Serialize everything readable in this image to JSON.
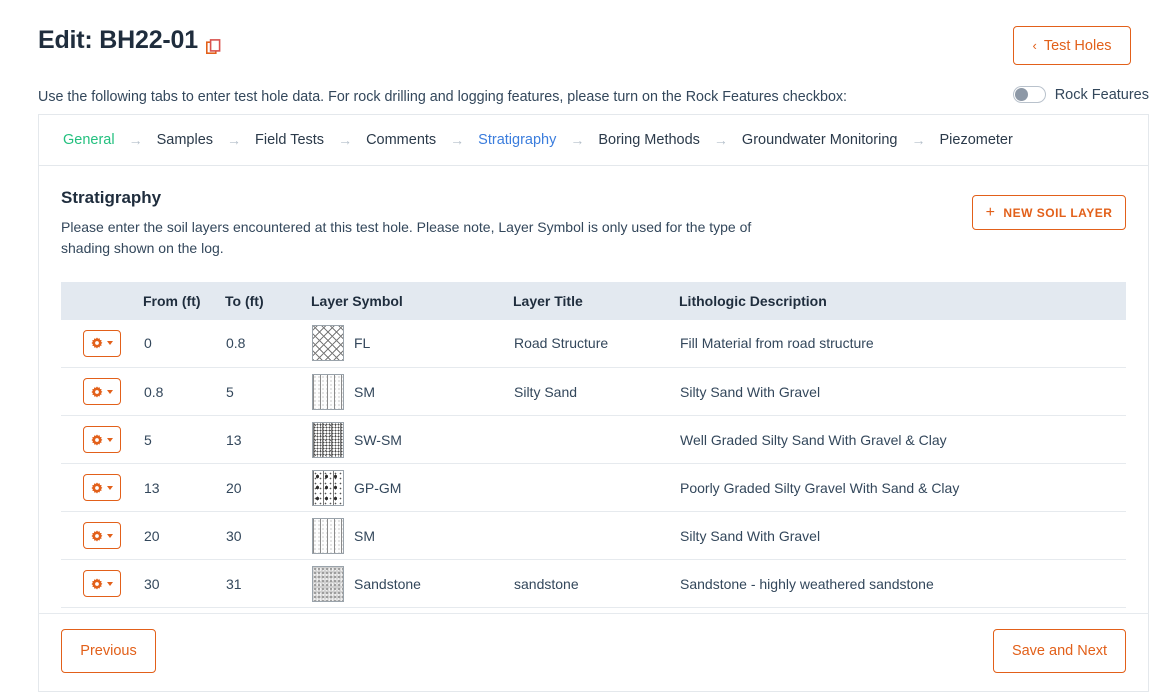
{
  "header": {
    "title": "Edit: BH22-01",
    "copy_icon": "copy-icon",
    "test_holes_label": "Test Holes",
    "back_chevron": "‹",
    "instructions": "Use the following tabs to enter test hole data. For rock drilling and logging features, please turn on the Rock Features checkbox:",
    "rock_features_label": "Rock Features",
    "rock_features_on": false
  },
  "tabs": [
    {
      "label": "General",
      "state": "green"
    },
    {
      "label": "Samples",
      "state": "default"
    },
    {
      "label": "Field Tests",
      "state": "default"
    },
    {
      "label": "Comments",
      "state": "default"
    },
    {
      "label": "Stratigraphy",
      "state": "blue"
    },
    {
      "label": "Boring Methods",
      "state": "default"
    },
    {
      "label": "Groundwater Monitoring",
      "state": "default"
    },
    {
      "label": "Piezometer",
      "state": "default"
    }
  ],
  "tab_separator": "→",
  "section": {
    "title": "Stratigraphy",
    "description": "Please enter the soil layers encountered at this test hole. Please note, Layer Symbol is only used for the type of shading shown on the log.",
    "new_layer_label": "NEW SOIL LAYER",
    "new_layer_icon": "plus-icon"
  },
  "table": {
    "columns": [
      "",
      "From (ft)",
      "To (ft)",
      "Layer Symbol",
      "Layer Title",
      "Lithologic Description"
    ],
    "rows": [
      {
        "from": "0",
        "to": "0.8",
        "symbol_label": "FL",
        "symbol_pattern": "pat-fl",
        "layer_title": "Road Structure",
        "description": "Fill Material from road structure"
      },
      {
        "from": "0.8",
        "to": "5",
        "symbol_label": "SM",
        "symbol_pattern": "pat-sm",
        "layer_title": "Silty Sand",
        "description": "Silty Sand With Gravel"
      },
      {
        "from": "5",
        "to": "13",
        "symbol_label": "SW-SM",
        "symbol_pattern": "pat-swsm",
        "layer_title": "",
        "description": "Well Graded Silty Sand With Gravel & Clay"
      },
      {
        "from": "13",
        "to": "20",
        "symbol_label": "GP-GM",
        "symbol_pattern": "pat-gpgm",
        "layer_title": "",
        "description": "Poorly Graded Silty Gravel With Sand & Clay"
      },
      {
        "from": "20",
        "to": "30",
        "symbol_label": "SM",
        "symbol_pattern": "pat-sm",
        "layer_title": "",
        "description": "Silty Sand With Gravel"
      },
      {
        "from": "30",
        "to": "31",
        "symbol_label": "Sandstone",
        "symbol_pattern": "pat-sandstone",
        "layer_title": "sandstone",
        "description": "Sandstone - highly weathered sandstone"
      }
    ],
    "row_action_icon": "gear-icon",
    "row_action_caret": "chevron-down-icon"
  },
  "footer": {
    "previous_label": "Previous",
    "save_label": "Save and Next"
  },
  "colors": {
    "accent_orange": "#e2601a",
    "tab_green": "#24c07f",
    "tab_blue": "#3b7ddd",
    "table_header_bg": "#e3e9f0",
    "text": "#33475b"
  }
}
